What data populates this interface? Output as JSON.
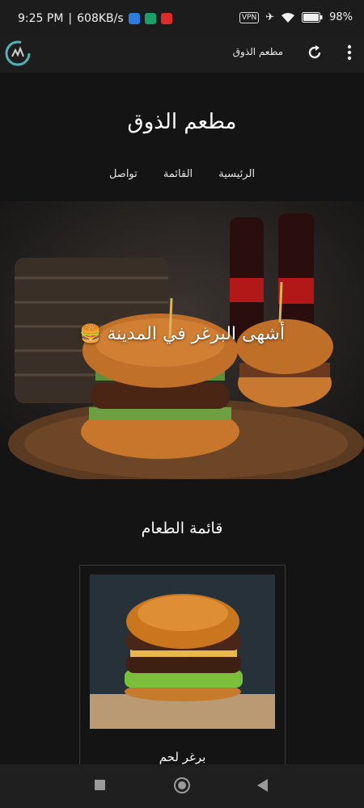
{
  "status_bar": {
    "time": "9:25 PM",
    "speed": "608KB/s",
    "vpn": "VPN",
    "battery": "98"
  },
  "app_bar": {
    "title": "مطعم الذوق"
  },
  "site": {
    "title": "مطعم الذوق",
    "nav": [
      "الرئيسية",
      "القائمة",
      "تواصل"
    ],
    "hero_text": "🍔 أشهى البرغر في المدينة",
    "menu_title": "قائمة الطعام",
    "menu_items": [
      {
        "name": "برغر لحم"
      }
    ]
  },
  "colors": {
    "background": "#141414",
    "bar": "#1d1d1d",
    "accent": "#4fb3b3"
  }
}
